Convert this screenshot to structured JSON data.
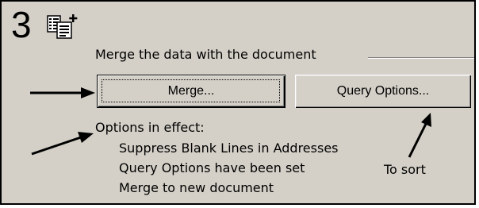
{
  "step": {
    "number": "3",
    "icon": "mail-merge-icon"
  },
  "section": {
    "label": "Merge the data with the document"
  },
  "buttons": {
    "merge_label": "Merge...",
    "query_options_label": "Query Options..."
  },
  "options": {
    "heading": "Options in effect:",
    "items": [
      "Suppress Blank Lines in Addresses",
      "Query Options have been set",
      "Merge to new document"
    ]
  },
  "annotation": {
    "to_sort": "To sort"
  }
}
